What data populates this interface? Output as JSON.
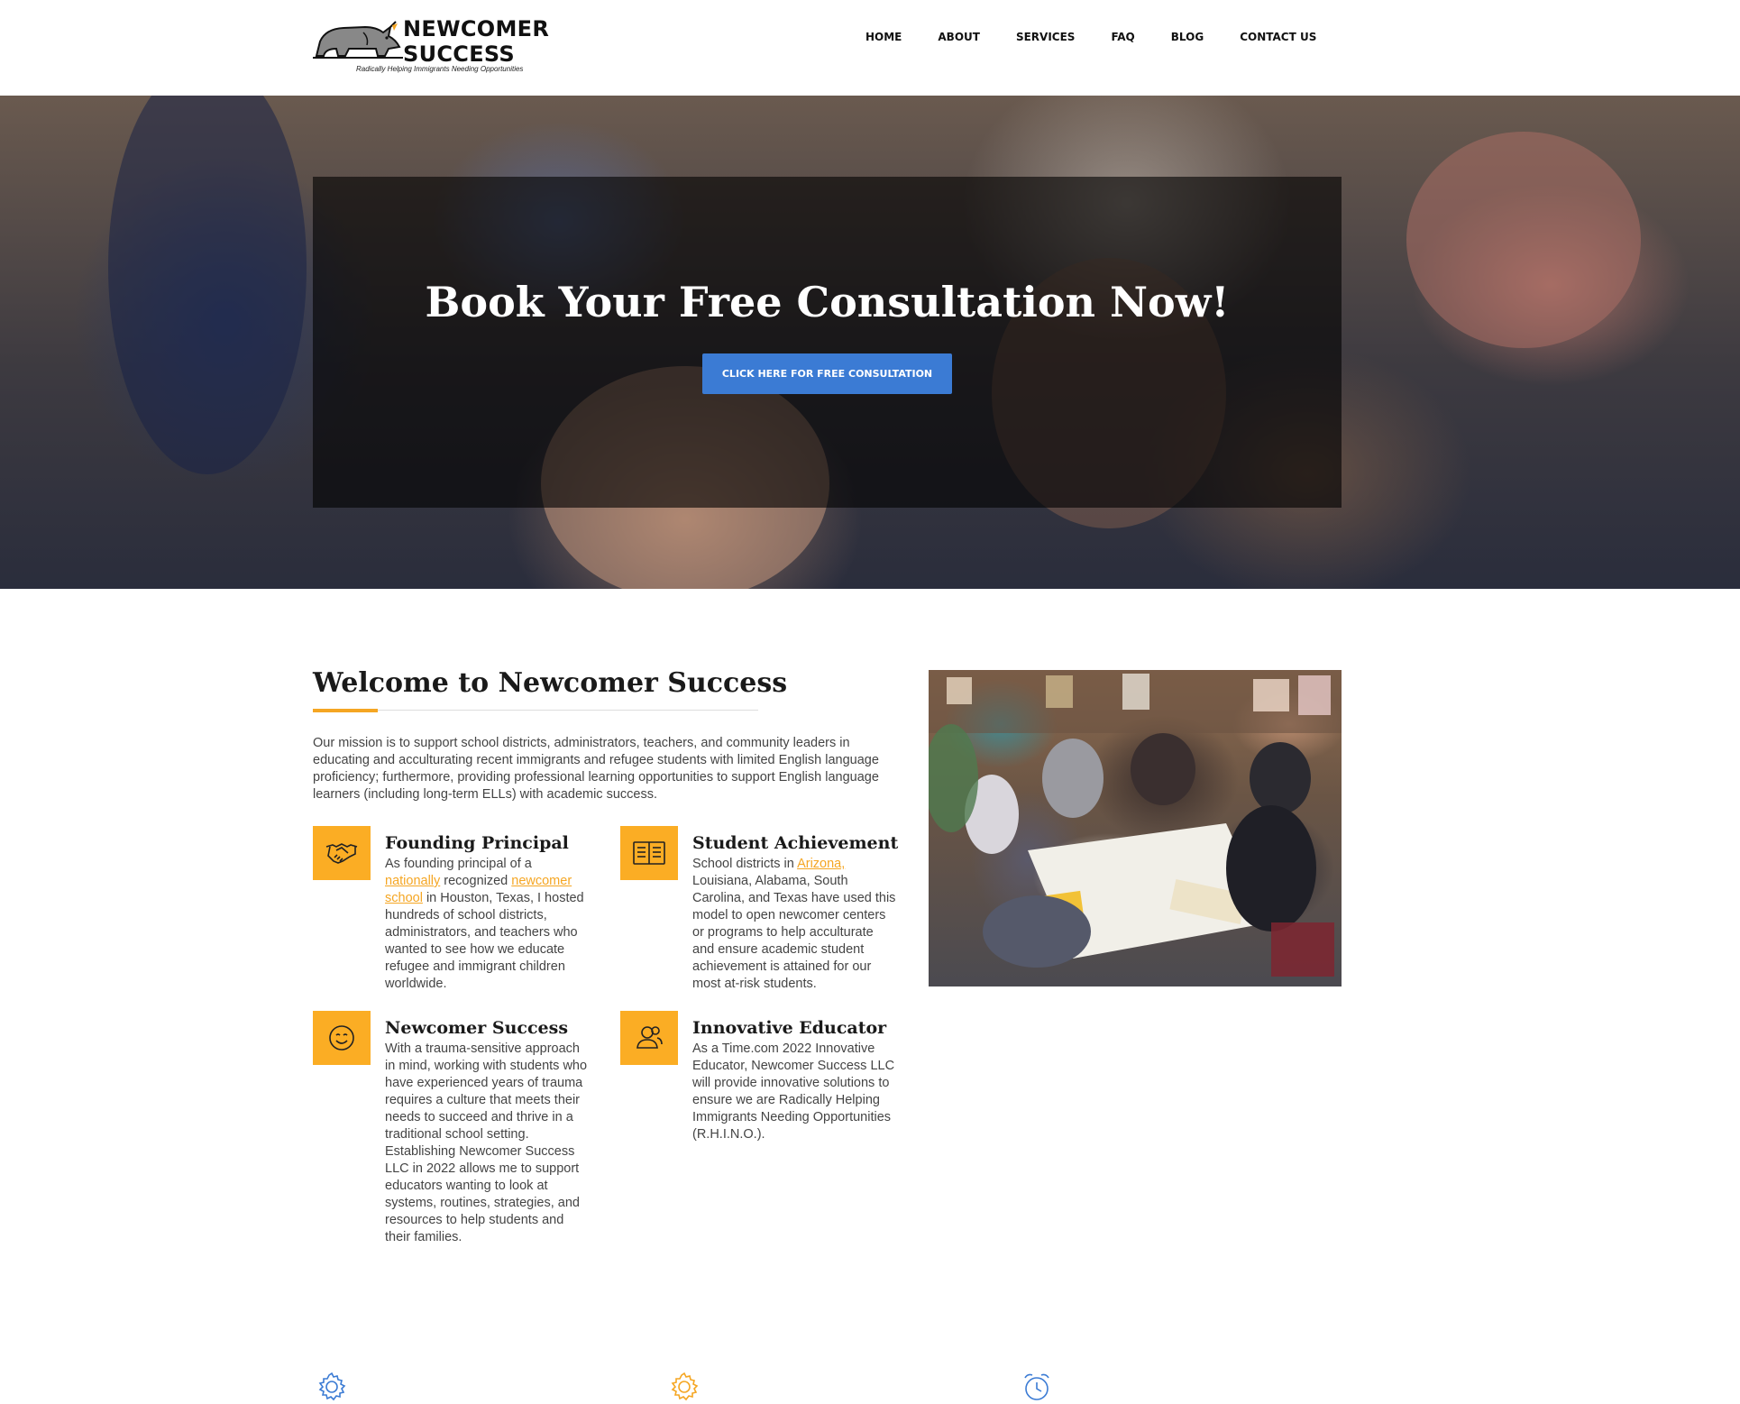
{
  "header": {
    "logo": {
      "line1": "NEWCOMER",
      "line2": "SUCCESS",
      "tagline": "Radically Helping Immigrants Needing Opportunities"
    },
    "nav": [
      {
        "label": "HOME"
      },
      {
        "label": "ABOUT"
      },
      {
        "label": "SERVICES"
      },
      {
        "label": "FAQ"
      },
      {
        "label": "BLOG"
      },
      {
        "label": "CONTACT US"
      }
    ]
  },
  "hero": {
    "title": "Book Your Free Consultation Now!",
    "button_label": "CLICK HERE FOR FREE CONSULTATION"
  },
  "welcome": {
    "title": "Welcome to Newcomer Success",
    "mission": "Our mission is to support school districts, administrators, teachers, and community leaders in educating and acculturating recent immigrants and refugee students with limited English language proficiency; furthermore, providing professional learning opportunities to support English language learners (including long-term ELLs) with academic success."
  },
  "features": {
    "founding": {
      "icon": "handshake-icon",
      "title": "Founding Principal",
      "text_1": "As founding principal of a ",
      "link_1": "nationally",
      "text_2": " recognized ",
      "link_2": "newcomer school",
      "text_3": " in Houston, Texas, I hosted hundreds of school districts, administrators, and teachers who wanted to see how we educate refugee and immigrant children worldwide."
    },
    "achievement": {
      "icon": "book-icon",
      "title": "Student Achievement",
      "text_1": "School districts in ",
      "link_1": "Arizona,",
      "text_2": " Louisiana, Alabama, South Carolina, and Texas have used this model to open newcomer centers or programs to help acculturate and ensure academic student achievement is attained for our most at-risk students."
    },
    "newcomer": {
      "icon": "smile-icon",
      "title": "Newcomer Success",
      "text": "With a trauma-sensitive approach in mind, working with students who have experienced years of trauma requires a culture that meets their needs to succeed and thrive in a traditional school setting. Establishing Newcomer Success LLC in 2022 allows me to support educators wanting to look at systems, routines, strategies, and resources to help students and their families."
    },
    "innovative": {
      "icon": "users-icon",
      "title": "Innovative Educator",
      "text": "As a Time.com 2022 Innovative Educator, Newcomer Success LLC will provide innovative solutions to ensure we are Radically Helping Immigrants Needing Opportunities (R.H.I.N.O.)."
    }
  },
  "bottom_icons": [
    "gear-icon",
    "gear-icon",
    "alarm-clock-icon"
  ],
  "colors": {
    "accent": "#f5a623",
    "icon_bg": "#fbad24",
    "button": "#3b7bd4",
    "blue_icon": "#3b7bd4"
  }
}
